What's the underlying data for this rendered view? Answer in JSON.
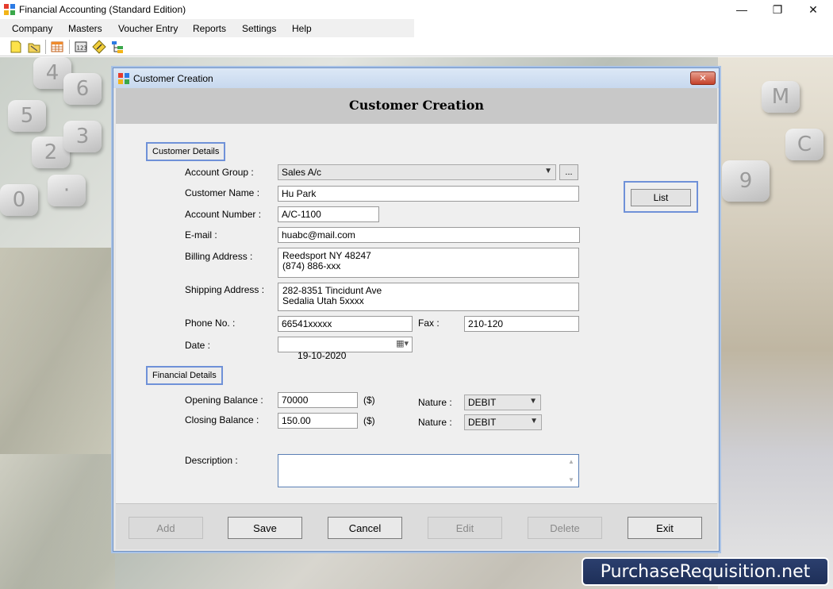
{
  "app": {
    "title": "Financial Accounting (Standard Edition)",
    "window_controls": {
      "minimize": "—",
      "maximize": "❐",
      "close": "✕"
    }
  },
  "menu": {
    "items": [
      {
        "label": "Company"
      },
      {
        "label": "Masters"
      },
      {
        "label": "Voucher Entry"
      },
      {
        "label": "Reports"
      },
      {
        "label": "Settings"
      },
      {
        "label": "Help"
      }
    ]
  },
  "toolbar": {
    "icons": [
      "new-file-icon",
      "open-folder-icon",
      "table-icon",
      "calculator-icon",
      "edit-icon",
      "tree-structure-icon"
    ]
  },
  "dialog": {
    "window_title": "Customer Creation",
    "heading": "Customer Creation",
    "close_label": "✕",
    "list_button": "List",
    "customer_section": "Customer Details",
    "financial_section": "Financial Details",
    "labels": {
      "account_group": "Account Group :",
      "customer_name": "Customer Name :",
      "account_number": "Account Number :",
      "email": "E-mail :",
      "billing_address": "Billing Address :",
      "shipping_address": "Shipping Address :",
      "phone": "Phone No. :",
      "fax": "Fax :",
      "date": "Date :",
      "opening_balance": "Opening Balance :",
      "closing_balance": "Closing Balance :",
      "nature_1": "Nature :",
      "nature_2": "Nature :",
      "description": "Description :"
    },
    "values": {
      "account_group": "Sales A/c",
      "browse_button": "...",
      "customer_name": "Hu Park",
      "account_number": "A/C-1100",
      "email": "huabc@mail.com",
      "billing_address": [
        "Reedsport NY 48247",
        "(874) 886-xxx"
      ],
      "shipping_address": [
        "282-8351 Tincidunt Ave",
        "Sedalia Utah 5xxxx"
      ],
      "phone": "66541xxxxx",
      "fax": "210-120",
      "date": "19-10-2020",
      "opening_balance": "70000",
      "closing_balance": "150.00",
      "currency_unit_1": "($)",
      "currency_unit_2": "($)",
      "nature_1": "DEBIT",
      "nature_2": "DEBIT",
      "description": ""
    },
    "footer_buttons": {
      "add": "Add",
      "save": "Save",
      "cancel": "Cancel",
      "edit": "Edit",
      "delete": "Delete",
      "exit": "Exit"
    }
  },
  "watermark": "PurchaseRequisition.net",
  "colors": {
    "section_border": "#6f91d8",
    "dialog_border": "#6f91c4",
    "watermark_bg": "#1e2f58"
  }
}
